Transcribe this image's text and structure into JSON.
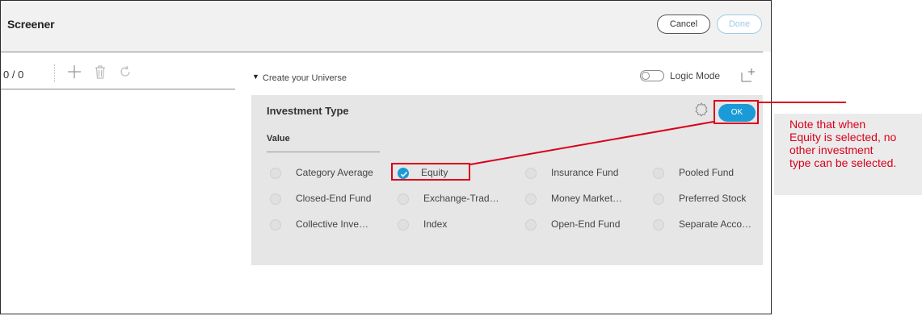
{
  "header": {
    "title": "Screener",
    "cancel_label": "Cancel",
    "done_label": "Done"
  },
  "left_panel": {
    "count": "0 / 0",
    "tools": [
      "add-icon",
      "trash-icon",
      "refresh-icon"
    ]
  },
  "universe": {
    "label": "Create your Universe",
    "logic_mode_label": "Logic Mode",
    "logic_mode_on": false
  },
  "investment_panel": {
    "title": "Investment Type",
    "ok_label": "OK",
    "value_label": "Value",
    "options": [
      {
        "label": "Category Average",
        "checked": false
      },
      {
        "label": "Equity",
        "checked": true
      },
      {
        "label": "Insurance Fund",
        "checked": false
      },
      {
        "label": "Pooled Fund",
        "checked": false
      },
      {
        "label": "Closed-End Fund",
        "checked": false
      },
      {
        "label": "Exchange-Trad…",
        "checked": false
      },
      {
        "label": "Money Market…",
        "checked": false
      },
      {
        "label": "Preferred Stock",
        "checked": false
      },
      {
        "label": "Collective Inve…",
        "checked": false
      },
      {
        "label": "Index",
        "checked": false
      },
      {
        "label": "Open-End Fund",
        "checked": false
      },
      {
        "label": "Separate Acco…",
        "checked": false
      }
    ]
  },
  "annotation": {
    "lines": [
      "Note that when",
      "Equity is selected, no",
      "other investment",
      "type can be selected."
    ],
    "color": "#d9001b"
  },
  "colors": {
    "accent": "#1a9bd7",
    "annotation": "#d9001b"
  }
}
